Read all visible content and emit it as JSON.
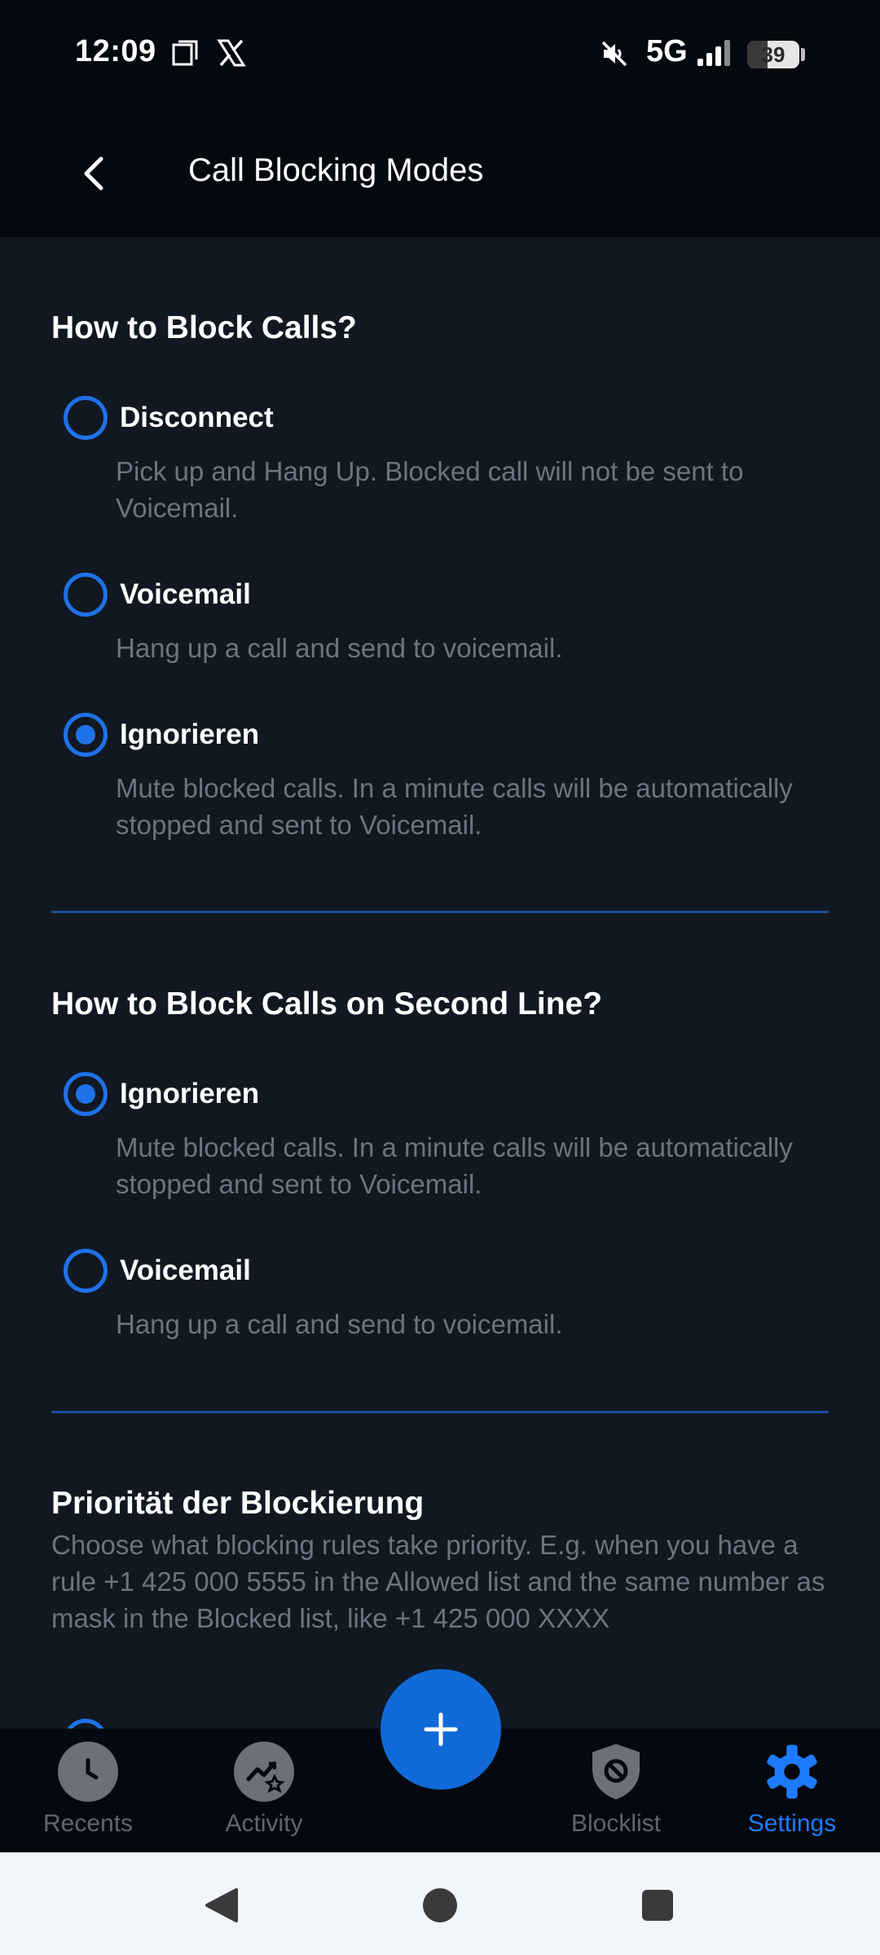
{
  "status_bar": {
    "time": "12:09",
    "network": "5G",
    "battery": "39",
    "battery_level": 0.39,
    "icons": [
      "screenshot-icon",
      "x-logo-icon",
      "mute-icon",
      "signal-icon",
      "battery-icon"
    ]
  },
  "app_bar": {
    "title": "Call Blocking Modes",
    "back_icon": "chevron-left-icon"
  },
  "section1": {
    "title": "How to Block Calls?",
    "options": [
      {
        "label": "Disconnect",
        "description": "Pick up and Hang Up. Blocked call will not be sent to Voicemail.",
        "selected": false
      },
      {
        "label": "Voicemail",
        "description": "Hang up a call and send to voicemail.",
        "selected": false
      },
      {
        "label": "Ignorieren",
        "description": "Mute blocked calls. In a minute calls will be automatically stopped and sent to Voicemail.",
        "selected": true
      }
    ]
  },
  "section2": {
    "title": "How to Block Calls on Second Line?",
    "options": [
      {
        "label": "Ignorieren",
        "description": "Mute blocked calls. In a minute calls will be automatically stopped and sent to Voicemail.",
        "selected": true
      },
      {
        "label": "Voicemail",
        "description": "Hang up a call and send to voicemail.",
        "selected": false
      }
    ]
  },
  "section3": {
    "title": "Priorität der Blockierung",
    "description": "Choose what blocking rules take priority. E.g. when you have a rule +1 425 000 5555 in the Allowed list and the same number as mask in the Blocked list, like +1 425 000 XXXX"
  },
  "bottom_nav": {
    "items": [
      {
        "label": "Recents",
        "icon": "clock-icon",
        "active": false
      },
      {
        "label": "Activity",
        "icon": "activity-chart-icon",
        "active": false
      },
      {
        "label": "Blocklist",
        "icon": "block-shield-icon",
        "active": false
      },
      {
        "label": "Settings",
        "icon": "gear-icon",
        "active": true
      }
    ],
    "fab_icon": "plus-icon"
  },
  "system_nav": {
    "icons": [
      "back-triangle-icon",
      "home-circle-icon",
      "recents-square-icon"
    ]
  },
  "colors": {
    "accent": "#1e72e8",
    "background": "#111821",
    "bar": "#05090f",
    "muted_text": "#6b7580",
    "active_nav": "#1e7bff"
  }
}
